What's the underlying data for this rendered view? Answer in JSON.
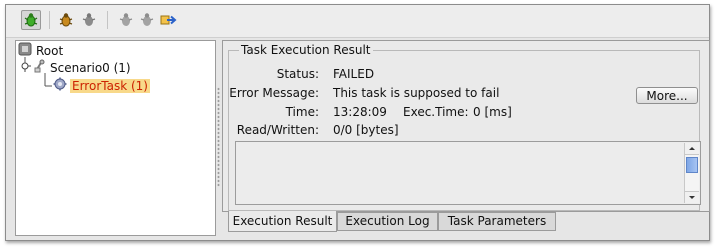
{
  "toolbar": {
    "buttons": [
      {
        "icon": "bug-icon",
        "pressed": true
      },
      {
        "icon": "bug-run-icon"
      },
      {
        "icon": "bug-disabled-icon"
      },
      {
        "icon": "bug-gray-icon"
      },
      {
        "icon": "bug-gray-icon"
      },
      {
        "icon": "export-arrow-icon"
      }
    ]
  },
  "tree": {
    "root": "Root",
    "scenario": "Scenario0 (1)",
    "task": "ErrorTask (1)"
  },
  "result": {
    "group_title": "Task Execution Result",
    "status_label": "Status:",
    "status_value": "FAILED",
    "error_label": "Error Message:",
    "error_value": "This task is supposed to fail",
    "more_button": "More...",
    "time_label": "Time:",
    "time_value": "13:28:09",
    "exec_label": "Exec.Time:",
    "exec_value": "0 [ms]",
    "rw_label": "Read/Written:",
    "rw_value": "0/0 [bytes]"
  },
  "tabs": [
    {
      "label": "Execution Result",
      "active": true
    },
    {
      "label": "Execution Log"
    },
    {
      "label": "Task Parameters"
    }
  ],
  "colors": {
    "selection_bg": "#f8d98a",
    "selection_text": "#cc2200",
    "bug_green": "#3fae2a",
    "scroll_thumb": "#8fb3ec"
  }
}
